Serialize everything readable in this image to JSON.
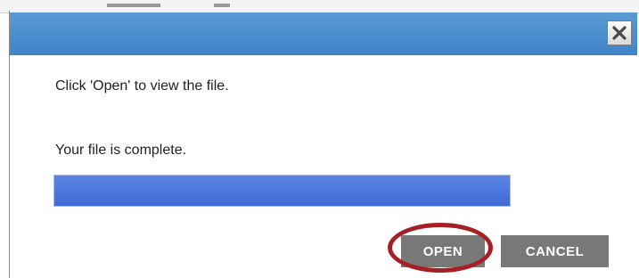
{
  "dialog": {
    "close_icon": "close-icon",
    "message": "Click 'Open' to view the file.",
    "status": "Your file is complete.",
    "progress": {
      "percent": 100,
      "fill_color": "#3f6ad6"
    },
    "buttons": {
      "open_label": "OPEN",
      "cancel_label": "CANCEL"
    },
    "highlight_color": "#a51f25",
    "titlebar_color": "#4a8ccf"
  }
}
